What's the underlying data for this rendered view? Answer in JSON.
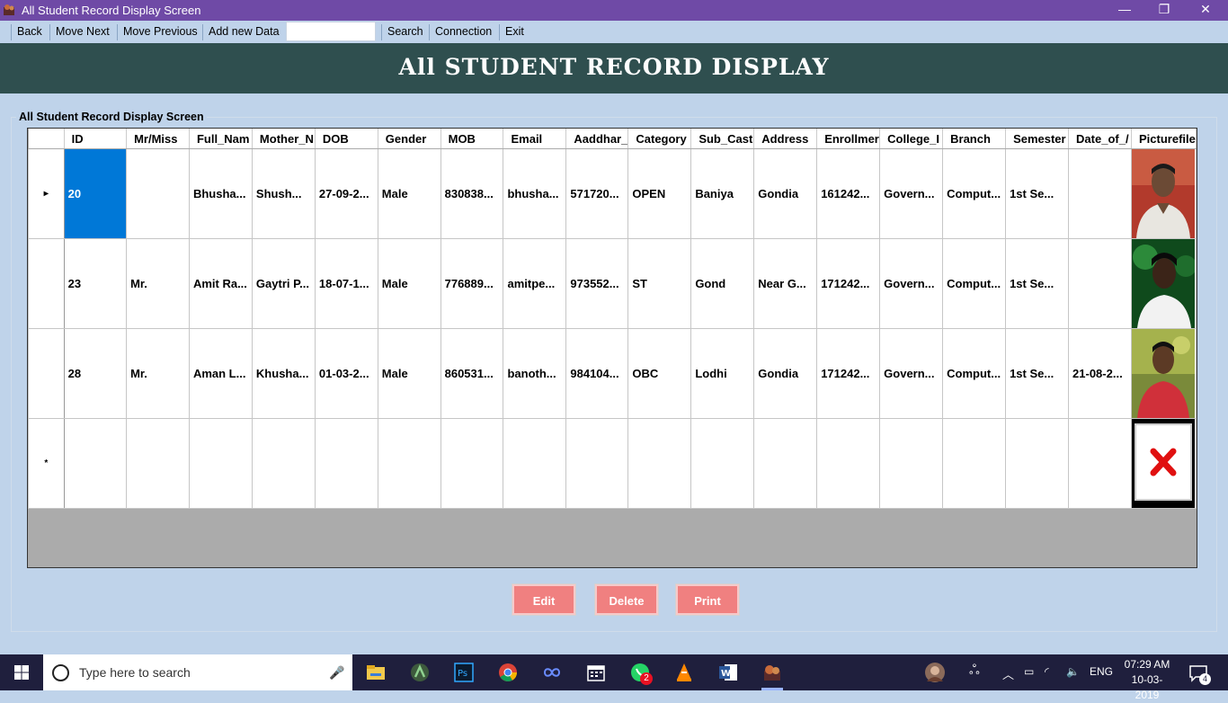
{
  "window": {
    "title": "All Student Record Display Screen",
    "controls": [
      "—",
      "❐",
      "✕"
    ]
  },
  "menu": {
    "items": [
      "Back",
      "Move Next",
      "Move Previous",
      "Add new Data",
      "Search",
      "Connection",
      "Exit"
    ],
    "search_value": ""
  },
  "header": {
    "title": "All STUDENT RECORD DISPLAY"
  },
  "group": {
    "label": "All Student Record Display Screen"
  },
  "grid": {
    "columns": [
      "ID",
      "Mr/Miss",
      "Full_Nam",
      "Mother_N",
      "DOB",
      "Gender",
      "MOB",
      "Email",
      "Aaddhar_",
      "Category",
      "Sub_Cast",
      "Address",
      "Enrollmer",
      "College_I",
      "Branch",
      "Semester",
      "Date_of_/",
      "Picturefile"
    ],
    "rows": [
      {
        "marker": "▸",
        "cells": [
          "20",
          "",
          "Bhusha...",
          "Shush...",
          "27-09-2...",
          "Male",
          "830838...",
          "bhusha...",
          "571720...",
          "OPEN",
          "Baniya",
          "Gondia",
          "161242...",
          "Govern...",
          "Comput...",
          "1st Se...",
          ""
        ],
        "picture": "photo-1"
      },
      {
        "marker": "",
        "cells": [
          "23",
          "Mr.",
          "Amit Ra...",
          "Gaytri P...",
          "18-07-1...",
          "Male",
          "776889...",
          "amitpe...",
          "973552...",
          "ST",
          "Gond",
          "Near G...",
          "171242...",
          "Govern...",
          "Comput...",
          "1st Se...",
          ""
        ],
        "picture": "photo-2"
      },
      {
        "marker": "",
        "cells": [
          "28",
          "Mr.",
          "Aman L...",
          "Khusha...",
          "01-03-2...",
          "Male",
          "860531...",
          "banoth...",
          "984104...",
          "OBC",
          "Lodhi",
          "Gondia",
          "171242...",
          "Govern...",
          "Comput...",
          "1st Se...",
          "21-08-2..."
        ],
        "picture": "photo-3"
      },
      {
        "marker": "*",
        "cells": [
          "",
          "",
          "",
          "",
          "",
          "",
          "",
          "",
          "",
          "",
          "",
          "",
          "",
          "",
          "",
          "",
          ""
        ],
        "picture": "broken-image"
      }
    ]
  },
  "buttons": {
    "edit": "Edit",
    "delete": "Delete",
    "print": "Print"
  },
  "taskbar": {
    "search_placeholder": "Type here to search",
    "whatsapp_badge": "2",
    "lang": "ENG",
    "time": "07:29 AM",
    "date": "10-03-2019",
    "notifications": "4"
  },
  "colors": {
    "titlebar": "#6f4aa6",
    "header": "#2f4f4f",
    "button": "#f08080",
    "selection": "#0078d7"
  }
}
